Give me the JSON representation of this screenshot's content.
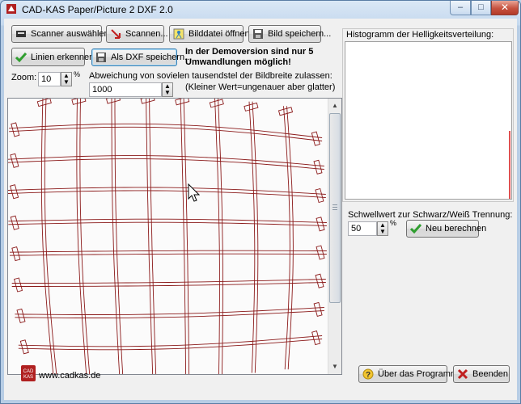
{
  "window": {
    "title": "CAD-KAS Paper/Picture 2 DXF 2.0",
    "controls": {
      "minimize": "–",
      "maximize": "□",
      "close": "✕"
    }
  },
  "toolbar": {
    "scanner_select": "Scanner auswählen",
    "scan": "Scannen...",
    "open_image": "Bilddatei öffnen...",
    "save_image": "Bild speichern...",
    "detect_lines": "Linien erkennen",
    "save_dxf": "Als DXF speichern..."
  },
  "demo_notice": {
    "line1": "In der Demoversion sind nur 5",
    "line2": "Umwandlungen möglich!"
  },
  "zoom": {
    "label": "Zoom:",
    "value": "10",
    "unit": "%"
  },
  "deviation": {
    "label": "Abweichung von sovielen tausendstel der Bildbreite zulassen:",
    "value": "1000",
    "hint": "(Kleiner Wert=ungenauer aber glatter)"
  },
  "histogram": {
    "label": "Histogramm der Helligkeitsverteilung:"
  },
  "threshold": {
    "label": "Schwellwert zur Schwarz/Weiß Trennung:",
    "value": "50",
    "unit": "%",
    "recalc_button": "Neu berechnen"
  },
  "footer": {
    "website": "www.cadkas.de",
    "about_button": "Über das Programm",
    "exit_button": "Beenden"
  },
  "colors": {
    "grid_stroke": "#8b1a1a",
    "accent_green": "#2f9e2f",
    "close_red": "#c6523f"
  }
}
